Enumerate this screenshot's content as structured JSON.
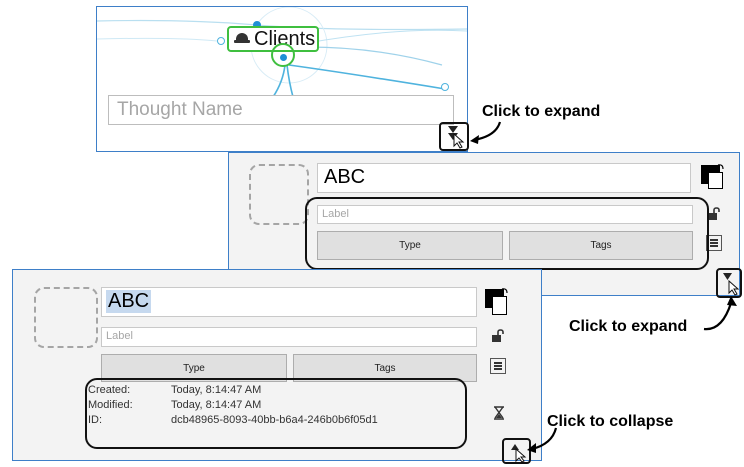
{
  "top_panel": {
    "thought_label": "Clients",
    "name_placeholder": "Thought Name"
  },
  "middle_panel": {
    "name_value": "ABC",
    "label_placeholder": "Label",
    "type_label": "Type",
    "tags_label": "Tags"
  },
  "bottom_panel": {
    "name_value": "ABC",
    "label_placeholder": "Label",
    "type_label": "Type",
    "tags_label": "Tags",
    "details": [
      {
        "label": "Created:",
        "value": "Today, 8:14:47 AM"
      },
      {
        "label": "Modified:",
        "value": "Today, 8:14:47 AM"
      },
      {
        "label": "ID:",
        "value": "dcb48965-8093-40bb-b6a4-246b0b6f05d1"
      }
    ]
  },
  "annotations": {
    "expand_1": "Click to expand",
    "expand_2": "Click to expand",
    "collapse": "Click to collapse"
  },
  "icons": [
    "thought-type-icon",
    "color-swap-icon",
    "lock-icon",
    "menu-icon",
    "hourglass-icon",
    "expand-toggle-icon",
    "collapse-toggle-icon",
    "cursor-icon"
  ]
}
